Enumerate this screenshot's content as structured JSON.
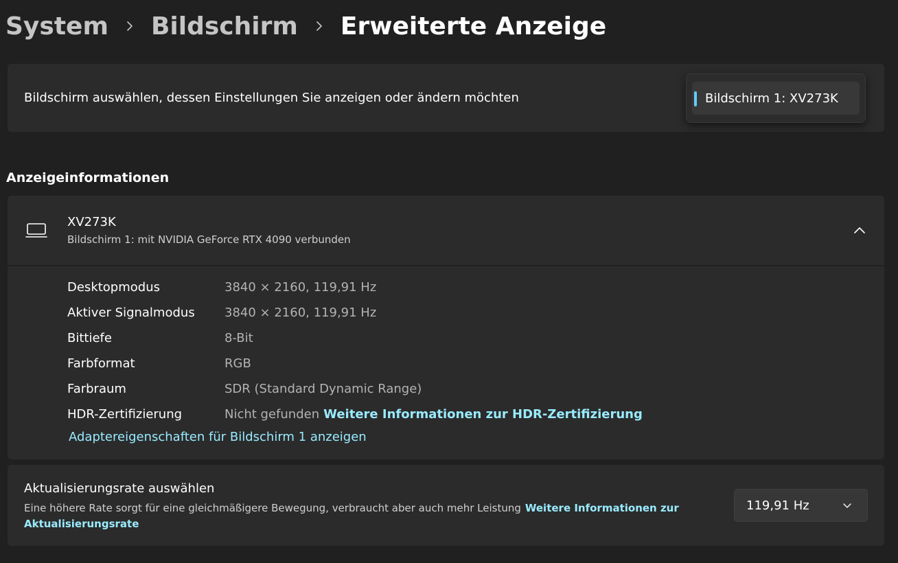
{
  "breadcrumb": {
    "items": [
      "System",
      "Bildschirm",
      "Erweiterte Anzeige"
    ]
  },
  "display_select": {
    "label": "Bildschirm auswählen, dessen Einstellungen Sie anzeigen oder ändern möchten",
    "selected": "Bildschirm 1: XV273K"
  },
  "section": {
    "heading": "Anzeigeinformationen"
  },
  "device": {
    "name": "XV273K",
    "subtitle": "Bildschirm 1: mit NVIDIA GeForce RTX 4090 verbunden",
    "icon": "monitor-icon",
    "collapse_icon": "chevron-up-icon"
  },
  "info_rows": [
    {
      "label": "Desktopmodus",
      "value": "3840 × 2160, 119,91 Hz"
    },
    {
      "label": "Aktiver Signalmodus",
      "value": "3840 × 2160, 119,91 Hz"
    },
    {
      "label": "Bittiefe",
      "value": "8-Bit"
    },
    {
      "label": "Farbformat",
      "value": "RGB"
    },
    {
      "label": "Farbraum",
      "value": "SDR (Standard Dynamic Range)"
    },
    {
      "label": "HDR-Zertifizierung",
      "value": "Nicht gefunden",
      "link": "Weitere Informationen zur HDR-Zertifizierung"
    }
  ],
  "adapter_link": "Adaptereigenschaften für Bildschirm 1 anzeigen",
  "refresh": {
    "title": "Aktualisierungsrate auswählen",
    "description": "Eine höhere Rate sorgt für eine gleichmäßigere Bewegung, verbraucht aber auch mehr Leistung",
    "link": "Weitere Informationen zur Aktualisierungsrate",
    "selected": "119,91 Hz",
    "chevron_icon": "chevron-down-icon"
  },
  "colors": {
    "background": "#202020",
    "card": "#2b2b2b",
    "accent": "#60cdff",
    "link": "#99ebff"
  }
}
